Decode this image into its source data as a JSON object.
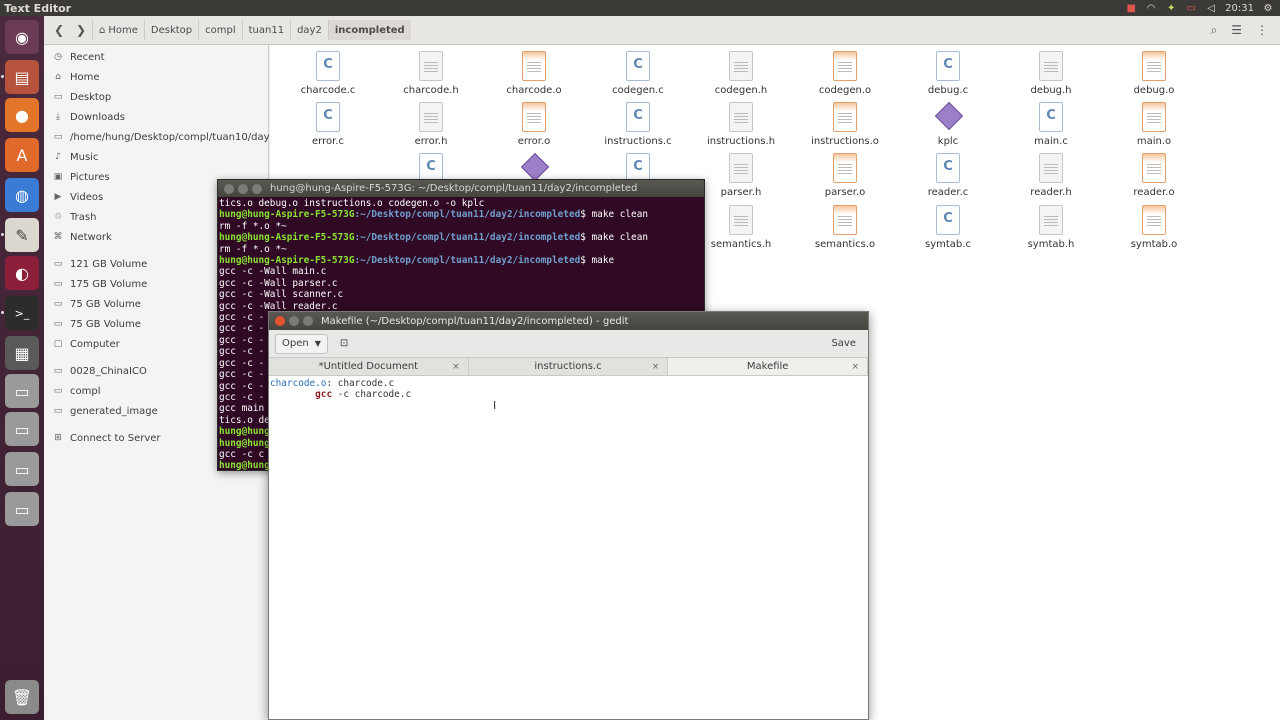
{
  "top_panel": {
    "title": "Text Editor",
    "clock": "20:31",
    "tray_icons": [
      "record-icon",
      "wifi-icon",
      "network-icon",
      "battery-icon",
      "volume-icon",
      "settings-icon"
    ]
  },
  "launcher": {
    "items": [
      {
        "name": "ubuntu-dash-icon",
        "glyph": "◉"
      },
      {
        "name": "files-icon",
        "glyph": "▤"
      },
      {
        "name": "firefox-icon",
        "glyph": "●"
      },
      {
        "name": "software-center-icon",
        "glyph": "A"
      },
      {
        "name": "chrome-icon",
        "glyph": "◍"
      },
      {
        "name": "text-editor-icon",
        "glyph": "✎"
      },
      {
        "name": "app-icon",
        "glyph": "◐"
      },
      {
        "name": "terminal-icon",
        "glyph": ">_"
      },
      {
        "name": "app2-icon",
        "glyph": "▦"
      },
      {
        "name": "drive-icon",
        "glyph": "▭"
      },
      {
        "name": "drive2-icon",
        "glyph": "▭"
      },
      {
        "name": "drive3-icon",
        "glyph": "▭"
      },
      {
        "name": "drive4-icon",
        "glyph": "▭"
      },
      {
        "name": "trash-icon",
        "glyph": "🗑"
      }
    ]
  },
  "fm": {
    "breadcrumbs": [
      "Home",
      "Desktop",
      "compl",
      "tuan11",
      "day2",
      "incompleted"
    ],
    "sidebar": [
      {
        "label": "Recent",
        "icon": "clock-icon"
      },
      {
        "label": "Home",
        "icon": "home-icon"
      },
      {
        "label": "Desktop",
        "icon": "folder-icon"
      },
      {
        "label": "Downloads",
        "icon": "download-icon"
      },
      {
        "label": "/home/hung/Desktop/compl/tuan10/day1",
        "icon": "folder-icon"
      },
      {
        "label": "Music",
        "icon": "music-icon"
      },
      {
        "label": "Pictures",
        "icon": "pictures-icon"
      },
      {
        "label": "Videos",
        "icon": "videos-icon"
      },
      {
        "label": "Trash",
        "icon": "trash-icon"
      },
      {
        "label": "Network",
        "icon": "network-icon"
      },
      {
        "label": "121 GB Volume",
        "icon": "drive-icon"
      },
      {
        "label": "175 GB Volume",
        "icon": "drive-icon"
      },
      {
        "label": "75 GB Volume",
        "icon": "drive-icon"
      },
      {
        "label": "75 GB Volume",
        "icon": "drive-icon"
      },
      {
        "label": "Computer",
        "icon": "computer-icon"
      },
      {
        "label": "0028_ChinaICO",
        "icon": "drive-icon"
      },
      {
        "label": "compl",
        "icon": "drive-icon"
      },
      {
        "label": "generated_image",
        "icon": "drive-icon"
      },
      {
        "label": "Connect to Server",
        "icon": "server-icon"
      }
    ],
    "files_row1": [
      "charcode.c",
      "charcode.h",
      "charcode.o",
      "codegen.c",
      "codegen.h",
      "codegen.o",
      "debug.c",
      "debug.h",
      "debug.o"
    ],
    "files_row2": [
      "error.c",
      "error.h",
      "error.o",
      "instructions.c",
      "instructions.h",
      "instructions.o",
      "kplc",
      "main.c",
      "main.o"
    ],
    "files_row3": [
      "parser.h",
      "parser.o",
      "reader.c",
      "reader.h",
      "reader.o"
    ],
    "files_row4": [
      "semantics.h",
      "semantics.o",
      "symtab.c",
      "symtab.h",
      "symtab.o"
    ]
  },
  "terminal": {
    "title": "hung@hung-Aspire-F5-573G: ~/Desktop/compl/tuan11/day2/incompleted",
    "prompt_user": "hung@hung-Aspire-F5-573G",
    "prompt_path": ":~/Desktop/compl/tuan11/day2/incompleted",
    "line1": "tics.o debug.o instructions.o codegen.o -o kplc",
    "cmd1": "$ make clean",
    "out1": "rm -f *.o *~",
    "cmd2": "$ make clean",
    "out2": "rm -f *.o *~",
    "cmd3": "$ make",
    "gcc_main": "gcc -c -Wall main.c",
    "gcc_parser": "gcc -c -Wall parser.c",
    "gcc_scanner": "gcc -c -Wall scanner.c",
    "gcc_reader": "gcc -c -Wall reader.c",
    "gcc_partial": "gcc -c -",
    "gcc_main2": "gcc main",
    "tics_de": "tics.o de",
    "hung_short": "hung@hung",
    "gcc_c": "gcc -c c",
    "hung_last": "hung@hung"
  },
  "gedit": {
    "title": "Makefile (~/Desktop/compl/tuan11/day2/incompleted) - gedit",
    "open_label": "Open",
    "save_label": "Save",
    "tabs": [
      "*Untitled Document",
      "instructions.c",
      "Makefile"
    ],
    "code_target": "charcode.o",
    "code_dep": ": charcode.c",
    "code_cmd": "gcc",
    "code_args": " -c charcode.c"
  }
}
